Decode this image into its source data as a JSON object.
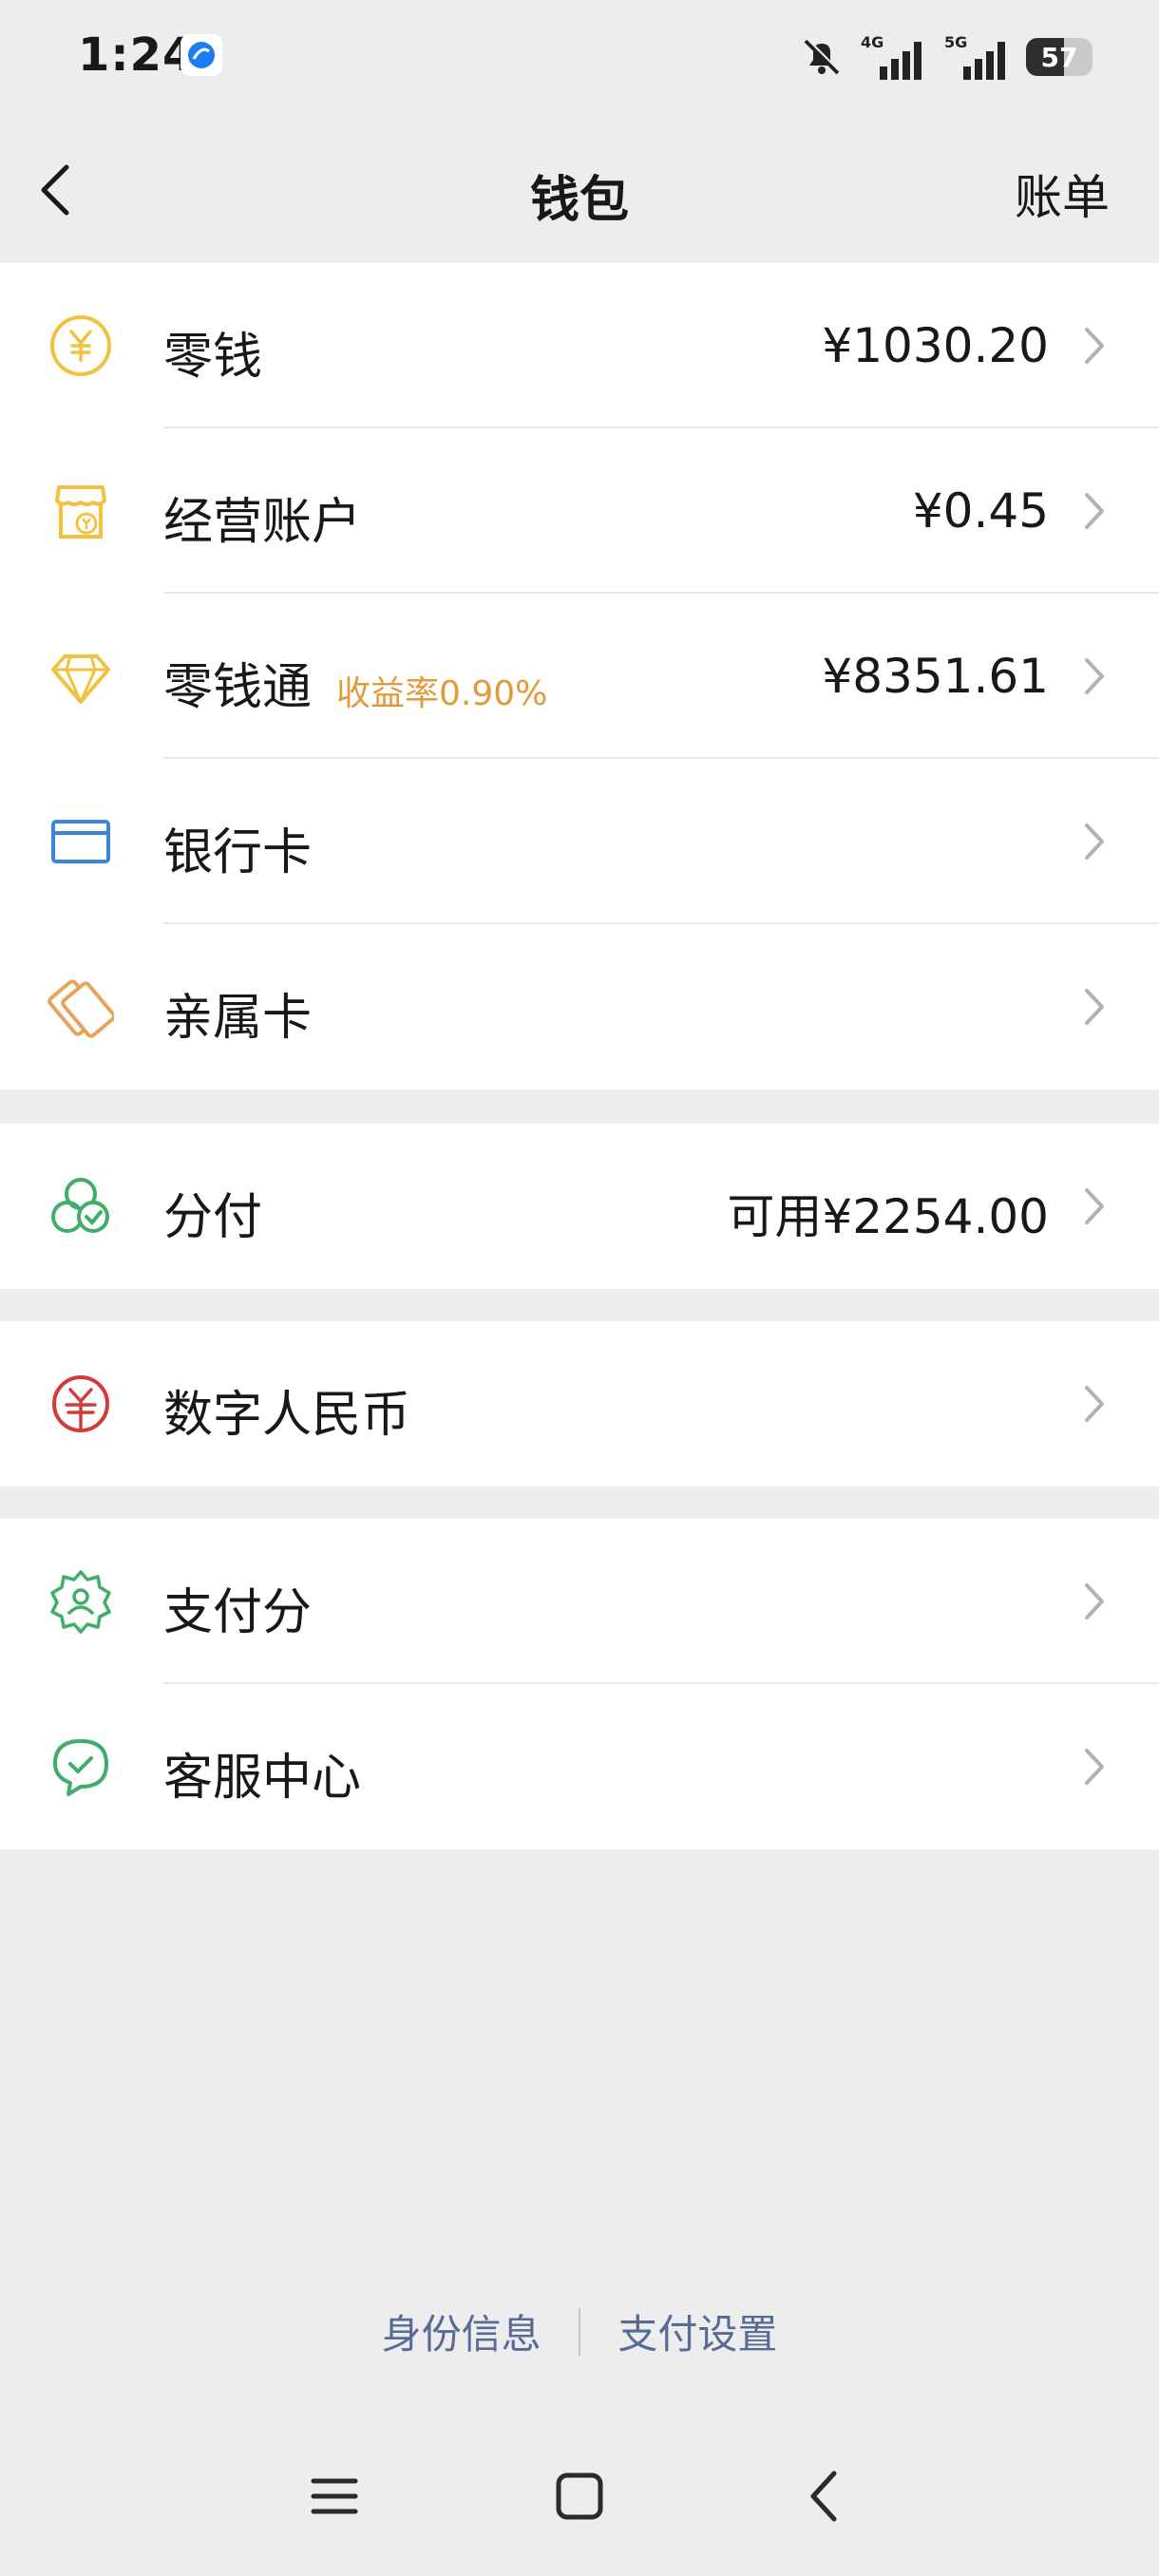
{
  "status_bar": {
    "time": "1:24",
    "network_1": "4G",
    "network_2": "5G",
    "battery": "57"
  },
  "header": {
    "title": "钱包",
    "right_action": "账单"
  },
  "groups": [
    {
      "items": [
        {
          "label": "零钱",
          "value": "¥1030.20",
          "icon": "yuan-coin-icon",
          "color": "#f0c23f"
        },
        {
          "label": "经营账户",
          "value": "¥0.45",
          "icon": "shop-account-icon",
          "color": "#f0c23f"
        },
        {
          "label": "零钱通",
          "tag": "收益率0.90%",
          "value": "¥8351.61",
          "icon": "diamond-icon",
          "color": "#f0c23f"
        },
        {
          "label": "银行卡",
          "value": "",
          "icon": "bank-card-icon",
          "color": "#3a86d8"
        },
        {
          "label": "亲属卡",
          "value": "",
          "icon": "family-card-icon",
          "color": "#e8a25a"
        }
      ]
    },
    {
      "items": [
        {
          "label": "分付",
          "value": "可用¥2254.00",
          "icon": "installment-icon",
          "color": "#3fae6a"
        }
      ]
    },
    {
      "items": [
        {
          "label": "数字人民币",
          "value": "",
          "icon": "digital-rmb-icon",
          "color": "#d33a3a"
        }
      ]
    },
    {
      "items": [
        {
          "label": "支付分",
          "value": "",
          "icon": "payscore-icon",
          "color": "#3fae6a"
        },
        {
          "label": "客服中心",
          "value": "",
          "icon": "customer-service-icon",
          "color": "#3fae6a"
        }
      ]
    }
  ],
  "footer": {
    "link_1": "身份信息",
    "link_2": "支付设置"
  },
  "colors": {
    "background": "#ededed",
    "link": "#576b95",
    "tag": "#e19a3c"
  }
}
